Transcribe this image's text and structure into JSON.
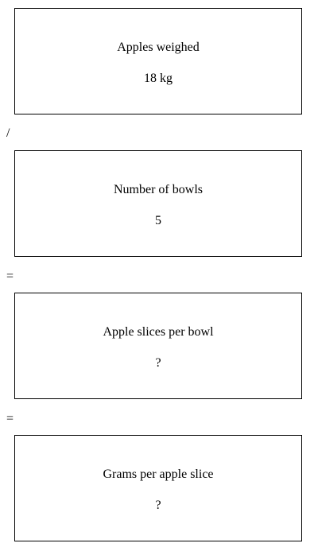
{
  "boxes": [
    {
      "label": "Apples weighed",
      "value": "18 kg"
    },
    {
      "label": "Number of bowls",
      "value": "5"
    },
    {
      "label": "Apple slices per bowl",
      "value": "?"
    },
    {
      "label": "Grams per apple slice",
      "value": "?"
    }
  ],
  "operators": [
    "/",
    "=",
    "="
  ]
}
